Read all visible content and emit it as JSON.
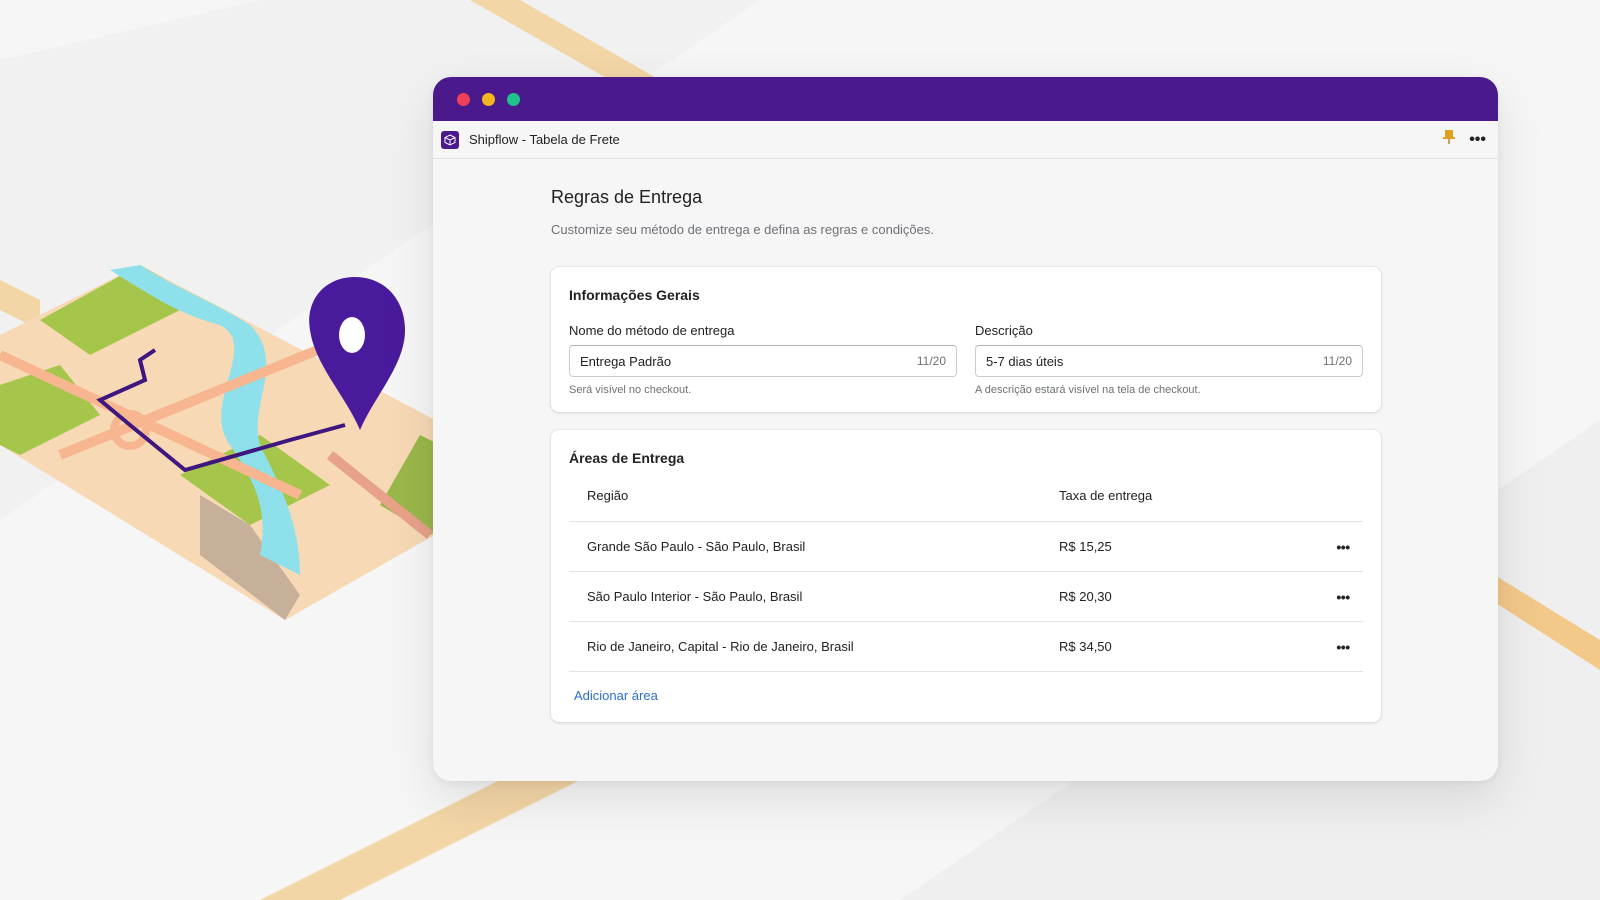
{
  "colors": {
    "brand": "#4a1a8c",
    "link": "#2c6ecb",
    "background": "#f6f6f7"
  },
  "window": {
    "traffic_lights": [
      "close",
      "minimize",
      "maximize"
    ]
  },
  "appbar": {
    "icon": "box-icon",
    "title": "Shipflow - Tabela de Frete",
    "pin_icon": "pin-icon",
    "more": "•••"
  },
  "page": {
    "title": "Regras de Entrega",
    "subtitle": "Customize seu método de entrega e defina as regras e condições."
  },
  "general_info": {
    "title": "Informações Gerais",
    "name_field": {
      "label": "Nome do método de entrega",
      "value": "Entrega Padrão",
      "count": "11/20",
      "help": "Será visível no checkout."
    },
    "description_field": {
      "label": "Descrição",
      "value": "5-7 dias úteis",
      "count": "11/20",
      "help": "A descrição estará visível na tela de checkout."
    }
  },
  "delivery_areas": {
    "title": "Áreas de Entrega",
    "columns": {
      "region": "Região",
      "fee": "Taxa de entrega"
    },
    "rows": [
      {
        "region": "Grande São Paulo - São Paulo, Brasil",
        "fee": "R$ 15,25",
        "action": "•••"
      },
      {
        "region": "São Paulo Interior - São Paulo, Brasil",
        "fee": "R$ 20,30",
        "action": "•••"
      },
      {
        "region": "Rio de Janeiro, Capital - Rio de Janeiro, Brasil",
        "fee": "R$ 34,50",
        "action": "•••"
      }
    ],
    "add_label": "Adicionar área"
  }
}
